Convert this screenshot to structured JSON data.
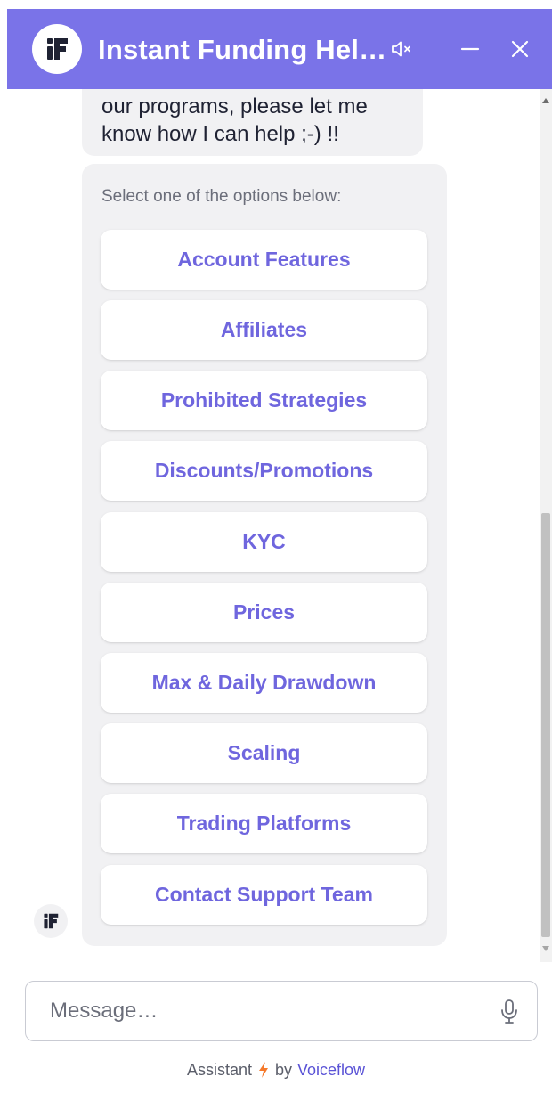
{
  "header": {
    "title": "Instant Funding Hel…",
    "bg_color": "#7a73e8",
    "icons": [
      "logo-icon",
      "mute-icon",
      "minimize-icon",
      "close-icon"
    ]
  },
  "messages": {
    "bubble_lines": [
      "our programs, please let me",
      "know how I can help ;-) !!"
    ]
  },
  "options": {
    "prompt": "Select one of the options below:",
    "accent_color": "#6f66de",
    "items": [
      "Account Features",
      "Affiliates",
      "Prohibited Strategies",
      "Discounts/Promotions",
      "KYC",
      "Prices",
      "Max & Daily Drawdown",
      "Scaling",
      "Trading Platforms",
      "Contact Support Team"
    ]
  },
  "composer": {
    "placeholder": "Message…",
    "mic_icon": "microphone-icon"
  },
  "footer": {
    "prefix": "Assistant",
    "bolt_icon": "lightning-bolt-icon",
    "bolt_color": "#f5792b",
    "by": "by",
    "brand": "Voiceflow"
  }
}
